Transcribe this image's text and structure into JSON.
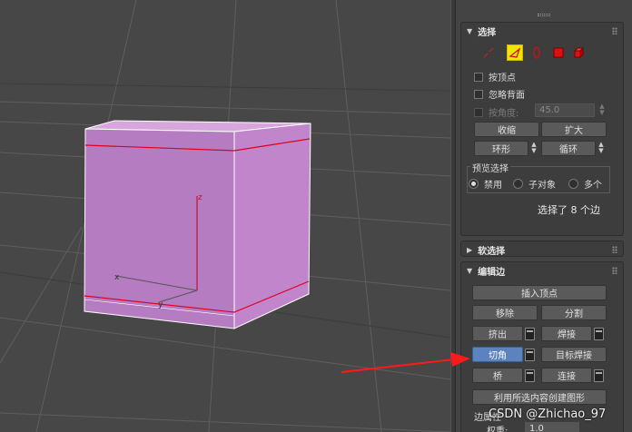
{
  "viewport": {
    "axis_labels": {
      "x": "x",
      "y": "y",
      "z": "z"
    },
    "colors": {
      "face_front": "#b67cc2",
      "face_side": "#c185cc",
      "face_top": "#d7a6dc",
      "edge": "#e00020",
      "background": "#474747"
    }
  },
  "selection": {
    "title": "选择",
    "icons": [
      "vertex-icon",
      "edge-icon",
      "border-icon",
      "polygon-icon",
      "element-icon"
    ],
    "by_vertex": "按顶点",
    "ignore_backfacing": "忽略背面",
    "by_angle": "按角度:",
    "angle_value": "45.0",
    "shrink": "收缩",
    "grow": "扩大",
    "ring": "环形",
    "loop": "循环",
    "preview_title": "预览选择",
    "preview_options": [
      "禁用",
      "子对象",
      "多个"
    ],
    "status": "选择了 8 个边"
  },
  "soft_selection": {
    "title": "软选择"
  },
  "edit_edges": {
    "title": "编辑边",
    "insert_vertex": "插入顶点",
    "remove": "移除",
    "split": "分割",
    "extrude": "挤出",
    "weld": "焊接",
    "chamfer": "切角",
    "target_weld": "目标焊接",
    "bridge": "桥",
    "connect": "连接",
    "create_shape": "利用所选内容创建图形",
    "edge_properties_label": "边属性",
    "weight_label": "权重:",
    "weight_value": "1.0"
  },
  "watermark": "CSDN @Zhichao_97",
  "accent_color": "#5b83bf",
  "arrow_color": "#ff1a1a"
}
